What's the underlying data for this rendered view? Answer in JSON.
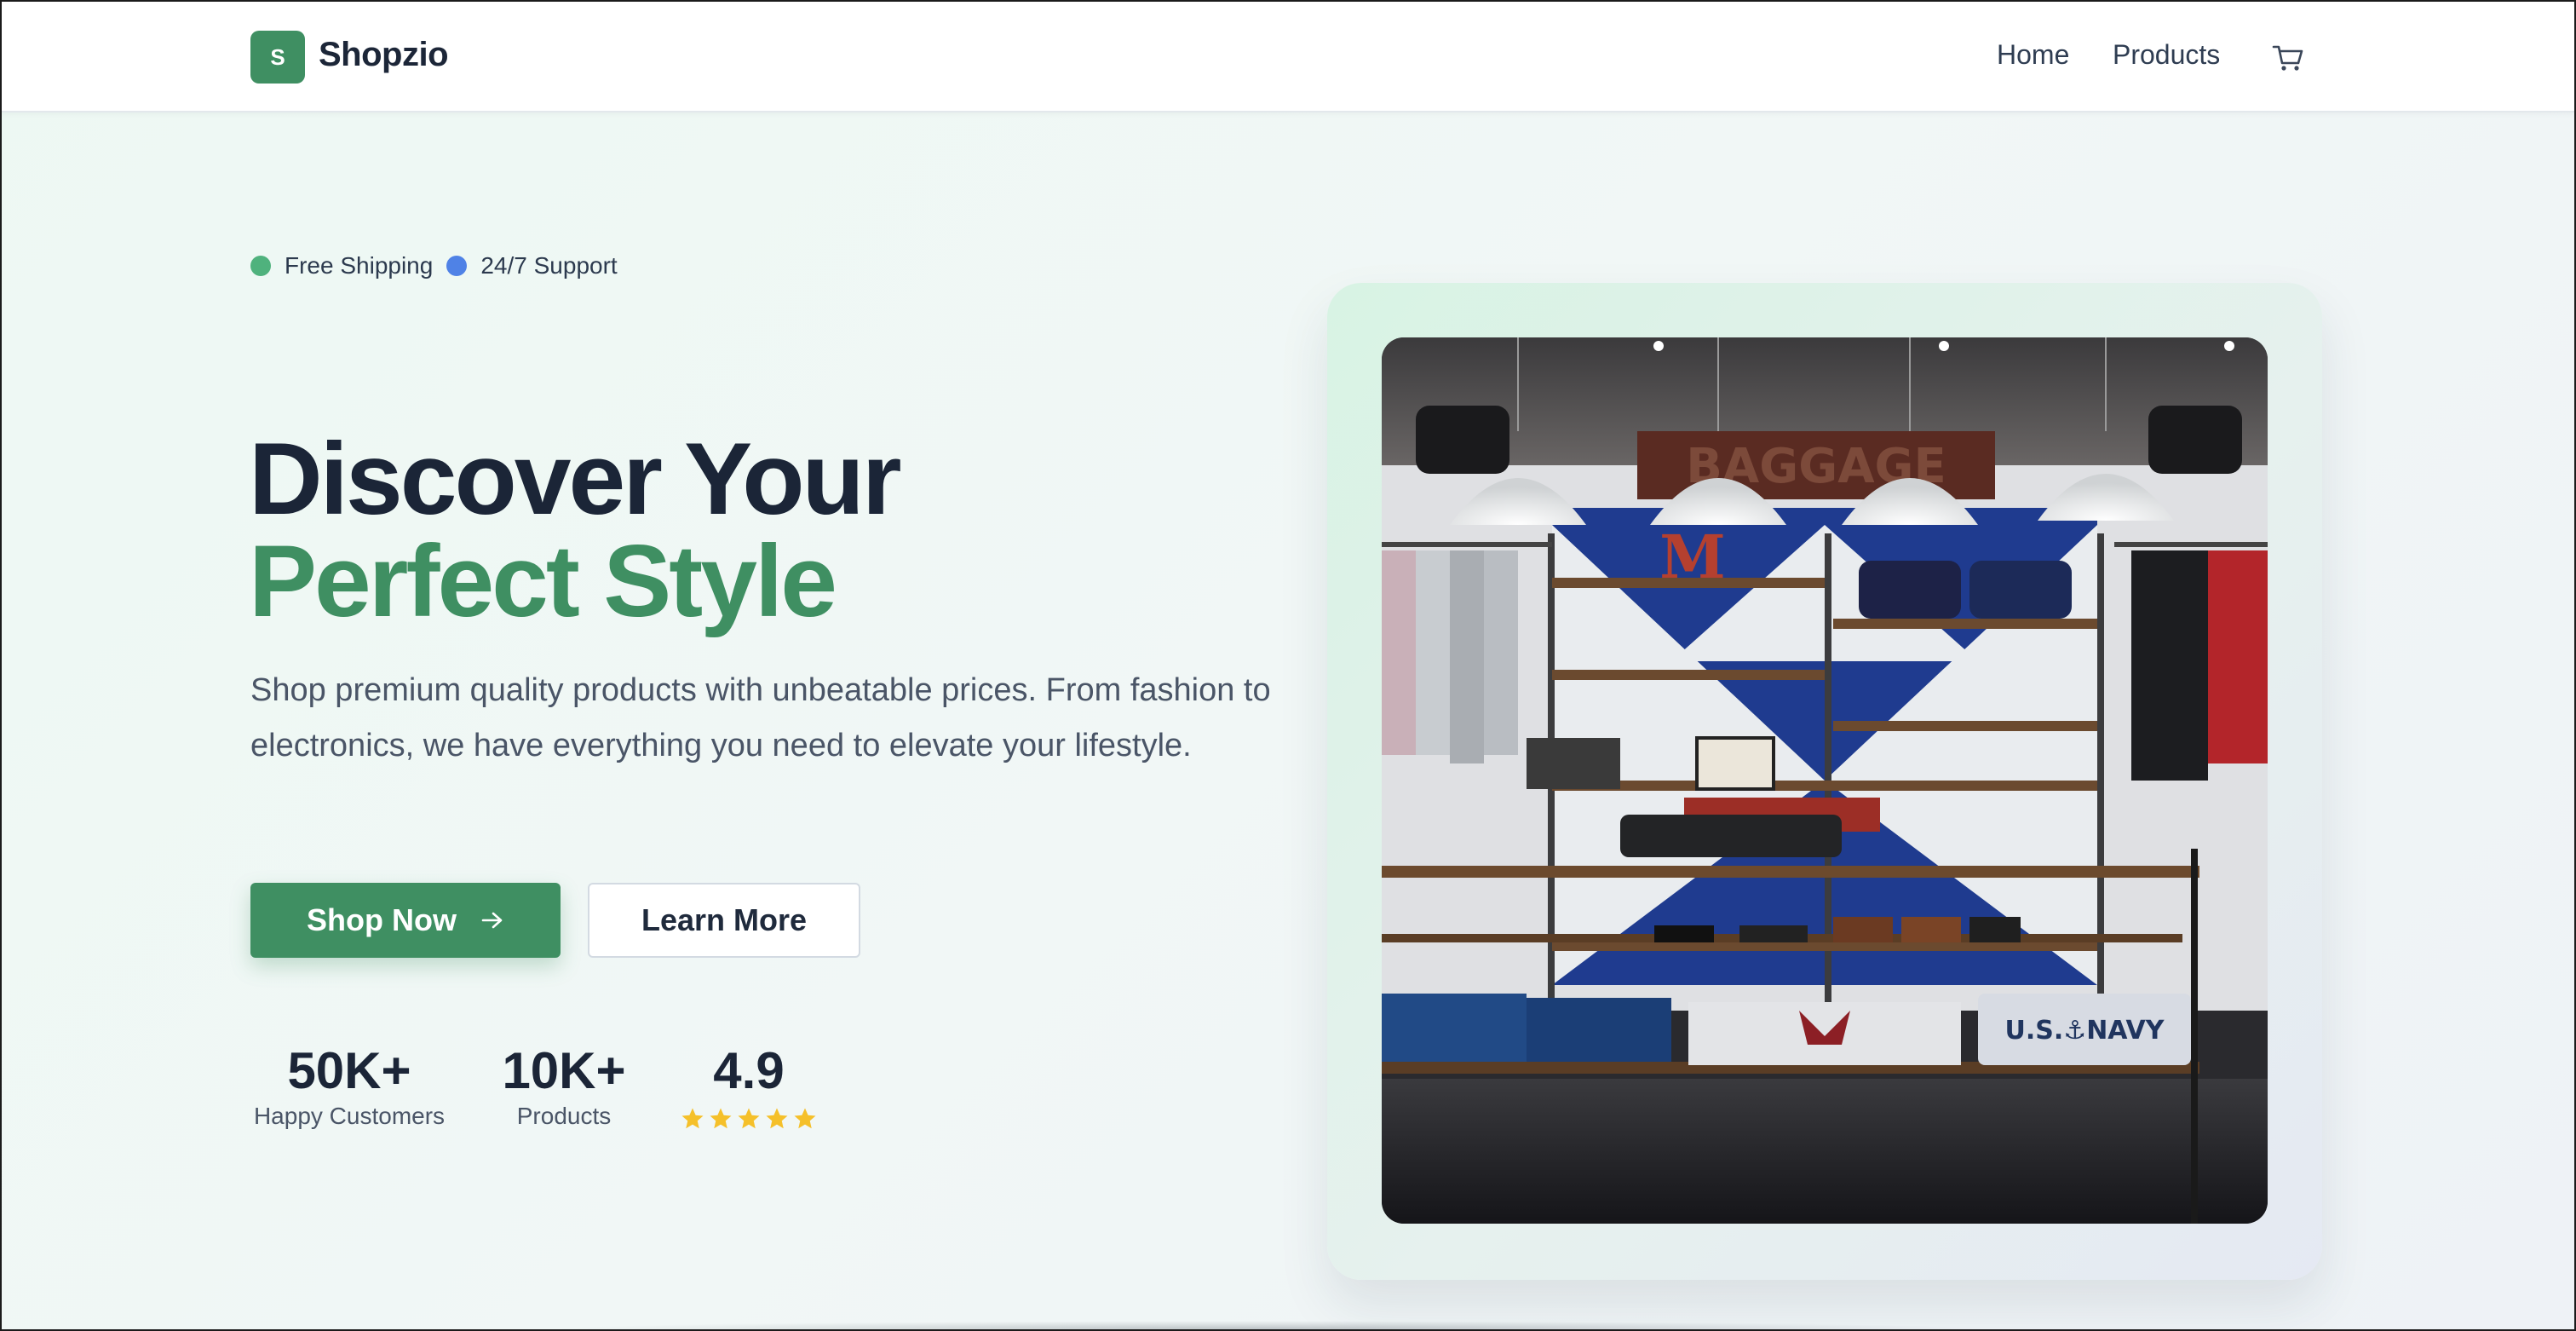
{
  "header": {
    "logo_letter": "S",
    "brand": "Shopzio",
    "nav": {
      "home": "Home",
      "products": "Products"
    },
    "cart_icon": "cart-icon"
  },
  "hero": {
    "badges": [
      "Free Shipping",
      "24/7 Support"
    ],
    "headline_line1": "Discover Your",
    "headline_line2": "Perfect Style",
    "description": "Shop premium quality products with unbeatable prices. From fashion to electronics, we have everything you need to elevate your lifestyle.",
    "primary_button": "Shop Now",
    "secondary_button": "Learn More",
    "stats": [
      {
        "value": "50K+",
        "label": "Happy Customers"
      },
      {
        "value": "10K+",
        "label": "Products"
      },
      {
        "value": "4.9",
        "rating_stars": 5
      }
    ],
    "image_caption_text": "U.S.⚓NAVY"
  },
  "colors": {
    "brand_green": "#3f8f62",
    "heading_dark": "#1b2537",
    "text_muted": "#4a5567",
    "badge_green": "#4fb27d",
    "badge_blue": "#4f82e6",
    "star_yellow": "#f5c02a"
  }
}
